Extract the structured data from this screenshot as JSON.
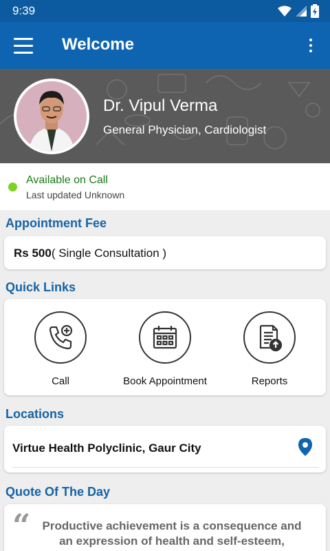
{
  "status_bar": {
    "time": "9:39"
  },
  "app_bar": {
    "title": "Welcome"
  },
  "doctor": {
    "name": "Dr. Vipul Verma",
    "specialty": "General Physician, Cardiologist"
  },
  "availability": {
    "status": "Available on Call",
    "updated": "Last updated Unknown",
    "color": "#7ed321"
  },
  "fee": {
    "section_title": "Appointment Fee",
    "amount": "Rs 500",
    "detail": "( Single Consultation )"
  },
  "quick_links": {
    "section_title": "Quick Links",
    "items": [
      {
        "label": "Call",
        "icon": "phone-add-icon"
      },
      {
        "label": "Book Appointment",
        "icon": "calendar-icon"
      },
      {
        "label": "Reports",
        "icon": "report-upload-icon"
      }
    ]
  },
  "locations": {
    "section_title": "Locations",
    "items": [
      {
        "name": "Virtue Health Polyclinic, Gaur City",
        "icon": "location-pin-icon"
      }
    ]
  },
  "quote": {
    "section_title": "Quote Of The Day",
    "text": "Productive achievement is a consequence and an expression of health and self-esteem,"
  },
  "colors": {
    "primary": "#0e64b0",
    "status_bar": "#0c5a9f",
    "section_title": "#1563a5",
    "available": "#1b7a18",
    "pin": "#0e64b0"
  }
}
